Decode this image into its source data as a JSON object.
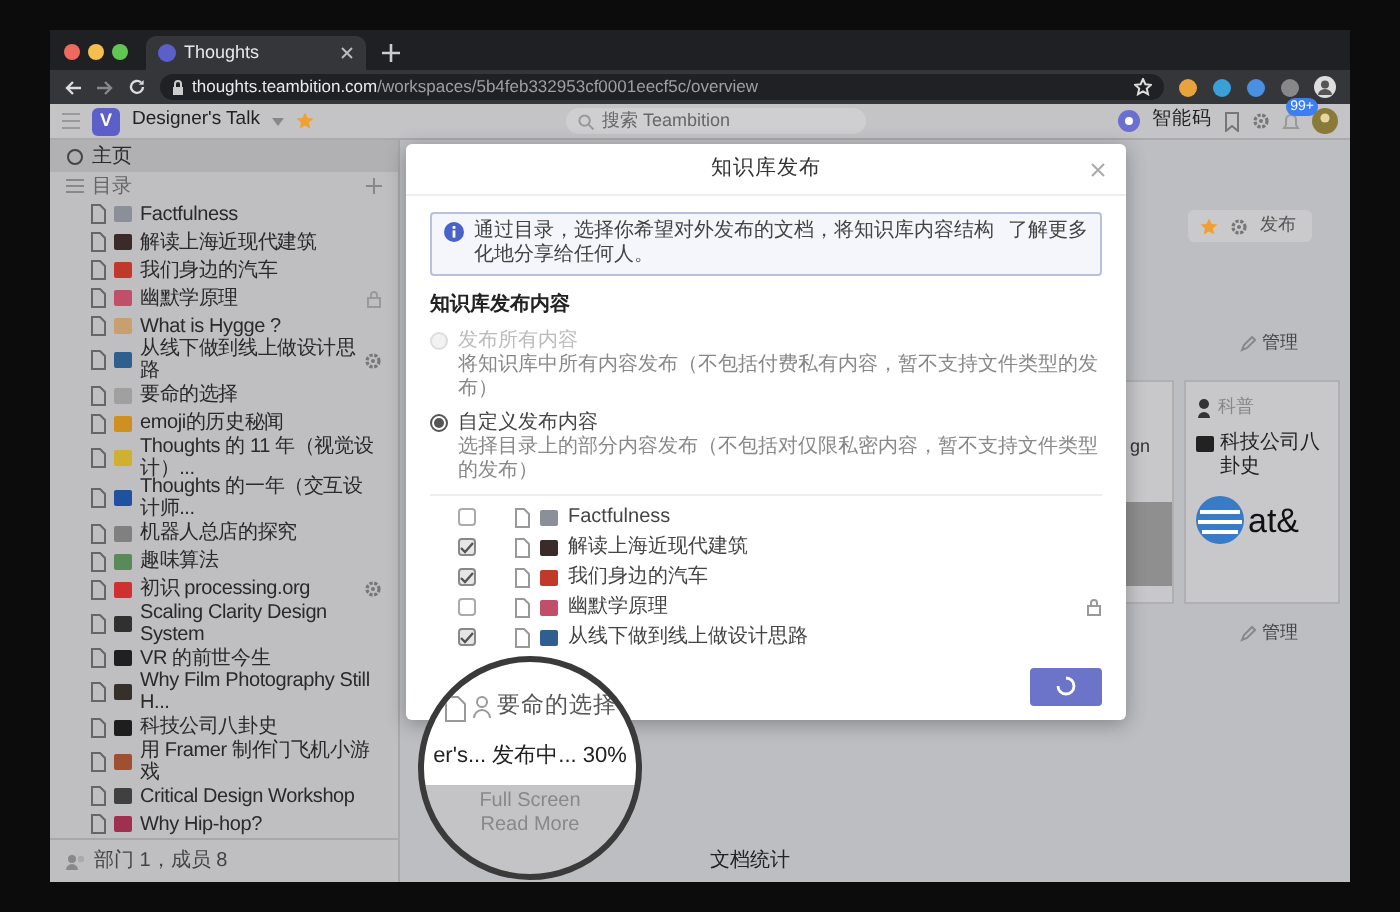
{
  "browser": {
    "tab_title": "Thoughts",
    "url_host": "thoughts.teambition.com",
    "url_path": "/workspaces/5b4feb332953cf0001eecf5c/overview"
  },
  "header": {
    "logo": "V",
    "workspace": "Designer's Talk",
    "search_placeholder": "搜索 Teambition",
    "shortcut": "智能码",
    "notification_badge": "99+"
  },
  "sidebar": {
    "home": {
      "label": "主页",
      "selected": true
    },
    "section": "目录",
    "items": [
      {
        "label": "Factfulness",
        "color": "#8a8f99",
        "locked": false,
        "settings": false,
        "selected": false
      },
      {
        "label": "解读上海近现代建筑",
        "color": "#3a2a2a",
        "locked": false,
        "settings": false,
        "selected": false
      },
      {
        "label": "我们身边的汽车",
        "color": "#c0392b",
        "locked": false,
        "settings": false,
        "selected": false
      },
      {
        "label": "幽默学原理",
        "color": "#c0506a",
        "locked": true,
        "settings": false,
        "selected": false
      },
      {
        "label": "What is Hygge ?",
        "color": "#c8a070",
        "locked": false,
        "settings": false,
        "selected": false
      },
      {
        "label": "从线下做到线上做设计思路",
        "color": "#2f5f8f",
        "locked": false,
        "settings": true,
        "selected": false
      },
      {
        "label": "要命的选择",
        "color": "#a0a0a0",
        "locked": false,
        "settings": false,
        "selected": false
      },
      {
        "label": "emoji的历史秘闻",
        "color": "#d09020",
        "locked": false,
        "settings": false,
        "selected": false
      },
      {
        "label": "Thoughts 的 11 年（视觉设计）...",
        "color": "#d0b030",
        "locked": false,
        "settings": false,
        "selected": false
      },
      {
        "label": "Thoughts 的一年（交互设计师...",
        "color": "#2050a0",
        "locked": false,
        "settings": false,
        "selected": false
      },
      {
        "label": "机器人总店的探究",
        "color": "#808080",
        "locked": false,
        "settings": false,
        "selected": false
      },
      {
        "label": "趣味算法",
        "color": "#5a8a5a",
        "locked": false,
        "settings": false,
        "selected": false
      },
      {
        "label": "初识 processing.org",
        "color": "#d03030",
        "locked": false,
        "settings": true,
        "selected": false
      },
      {
        "label": "Scaling Clarity Design System",
        "color": "#303030",
        "locked": false,
        "settings": false,
        "selected": false
      },
      {
        "label": "VR 的前世今生",
        "color": "#202020",
        "locked": false,
        "settings": false,
        "selected": false
      },
      {
        "label": "Why Film Photography Still H...",
        "color": "#35302a",
        "locked": false,
        "settings": false,
        "selected": false
      },
      {
        "label": "科技公司八卦史",
        "color": "#1e1e1e",
        "locked": false,
        "settings": false,
        "selected": false
      },
      {
        "label": "用 Framer 制作门飞机小游戏",
        "color": "#a05030",
        "locked": false,
        "settings": false,
        "selected": false
      },
      {
        "label": "Critical Design Workshop",
        "color": "#404040",
        "locked": false,
        "settings": false,
        "selected": false
      },
      {
        "label": "Why Hip-hop?",
        "color": "#a03050",
        "locked": false,
        "settings": false,
        "selected": false
      }
    ],
    "footer": "部门 1，成员 8"
  },
  "main": {
    "publish": "发布",
    "manage_labels": [
      "管理",
      "管理"
    ],
    "cards": [
      {
        "kind": "photo",
        "title": "gn"
      },
      {
        "kind": "logo",
        "author": "科普",
        "title": "科技公司八卦史",
        "logo_text": "at&"
      }
    ],
    "stats_title": "文档统计"
  },
  "modal": {
    "title": "知识库发布",
    "notice": "通过目录，选择你希望对外发布的文档，将知识库内容结构化地分享给任何人。",
    "notice_link": "了解更多",
    "section_title": "知识库发布内容",
    "options": [
      {
        "label": "发布所有内容",
        "description": "将知识库中所有内容发布（不包括付费私有内容，暂不支持文件类型的发布）",
        "selected": false,
        "disabled": true
      },
      {
        "label": "自定义发布内容",
        "description": "选择目录上的部分内容发布（不包括对仅限私密内容，暂不支持文件类型的发布）",
        "selected": true,
        "disabled": false
      }
    ],
    "tree": [
      {
        "label": "Factfulness",
        "color": "#8a8f99",
        "checked": false,
        "locked": false
      },
      {
        "label": "解读上海近现代建筑",
        "color": "#3a2a2a",
        "checked": true,
        "locked": false
      },
      {
        "label": "我们身边的汽车",
        "color": "#c0392b",
        "checked": true,
        "locked": false
      },
      {
        "label": "幽默学原理",
        "color": "#c0506a",
        "checked": false,
        "locked": true
      },
      {
        "label": "从线下做到线上做设计思路",
        "color": "#2f5f8f",
        "checked": true,
        "locked": false
      }
    ],
    "publish_button": {
      "loading": true
    },
    "magnifier": {
      "row_label": "要命的选择",
      "status": "er's... 发布中... 30%",
      "background_texts": [
        "Full Screen",
        "Read More"
      ]
    }
  }
}
